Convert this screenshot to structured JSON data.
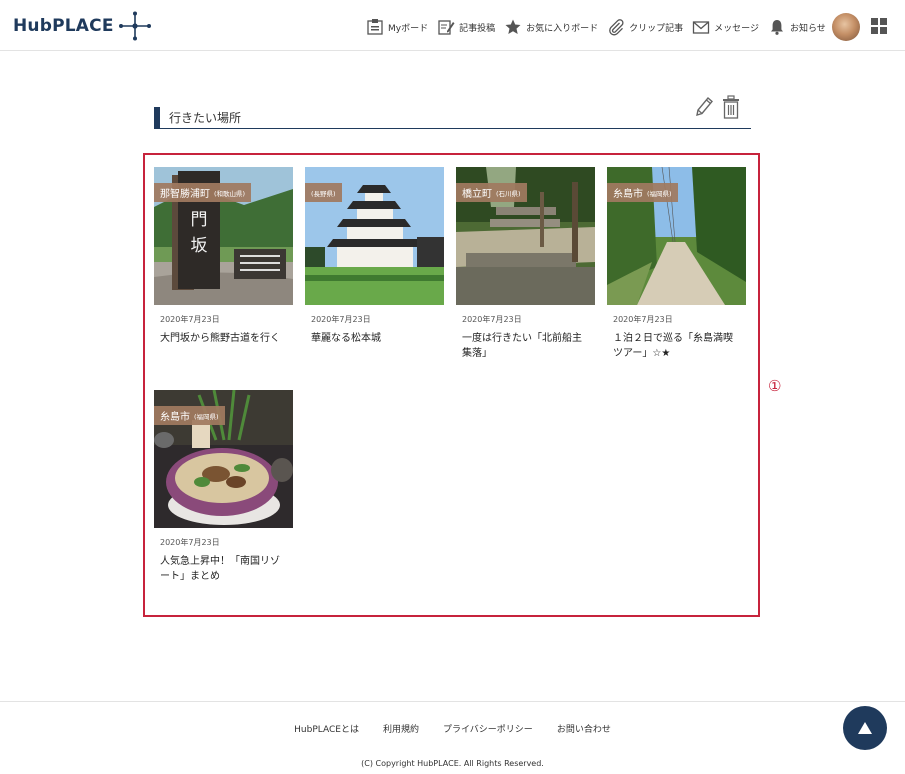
{
  "header": {
    "logo_text": "HubPLACE",
    "nav": [
      {
        "label": "Myボード",
        "icon": "board-icon"
      },
      {
        "label": "記事投稿",
        "icon": "compose-icon"
      },
      {
        "label": "お気に入りボード",
        "icon": "star-icon"
      },
      {
        "label": "クリップ記事",
        "icon": "paperclip-icon"
      },
      {
        "label": "メッセージ",
        "icon": "envelope-icon"
      },
      {
        "label": "お知らせ",
        "icon": "bell-icon"
      }
    ],
    "avatar_icon": "avatar",
    "menu_icon": "grid-menu-icon"
  },
  "board": {
    "title": "行きたい場所",
    "edit_icon": "pencil-icon",
    "delete_icon": "trash-icon"
  },
  "annotation": {
    "marker": "①",
    "color": "#c7233c"
  },
  "cards": [
    {
      "tag": "那智勝浦町",
      "tag_sub": "(和歌山県)",
      "date": "2020年7月23日",
      "title": "大門坂から熊野古道を行く"
    },
    {
      "tag": "",
      "tag_sub": "(長野県)",
      "date": "2020年7月23日",
      "title": "華麗なる松本城"
    },
    {
      "tag": "橋立町",
      "tag_sub": "(石川県)",
      "date": "2020年7月23日",
      "title": "一度は行きたい「北前船主集落」"
    },
    {
      "tag": "糸島市",
      "tag_sub": "(福岡県)",
      "date": "2020年7月23日",
      "title": "１泊２日で巡る「糸島満喫ツアー」☆★"
    },
    {
      "tag": "糸島市",
      "tag_sub": "(福岡県)",
      "date": "2020年7月23日",
      "title": "人気急上昇中！「南国リゾート」まとめ"
    }
  ],
  "footer": {
    "links": [
      "HubPLACEとは",
      "利用規約",
      "プライバシーポリシー",
      "お問い合わせ"
    ],
    "copyright": "(C) Copyright HubPLACE. All Rights Reserved."
  },
  "colors": {
    "brand": "#1f3a5c",
    "tag_bg": "#a07a60",
    "highlight": "#c7233c"
  }
}
